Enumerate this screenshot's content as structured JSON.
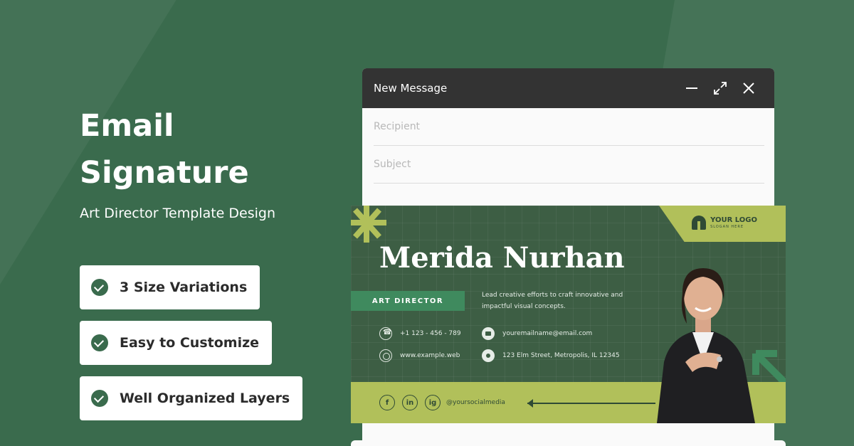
{
  "promo": {
    "headline_line1": "Email",
    "headline_line2": "Signature",
    "subtitle": "Art Director Template Design",
    "features": [
      {
        "label": "3 Size Variations"
      },
      {
        "label": "Easy to Customize"
      },
      {
        "label": "Well Organized Layers"
      }
    ]
  },
  "window": {
    "title": "New Message",
    "recipient_placeholder": "Recipient",
    "subject_placeholder": "Subject"
  },
  "signature": {
    "logo_text": "YOUR LOGO",
    "logo_slogan": "SLOGAN HERE",
    "name": "Merida Nurhan",
    "role": "ART DIRECTOR",
    "bio": "Lead creative efforts to craft innovative and impactful visual concepts.",
    "phone": "+1 123 - 456 - 789",
    "website": "www.example.web",
    "email": "youremailname@email.com",
    "address": "123 Elm Street, Metropolis, IL 12345",
    "social_handle": "@yoursocialmedia",
    "social_icons": [
      "f",
      "in",
      "ig"
    ]
  },
  "colors": {
    "background": "#3a6b4d",
    "card_green": "#3d5e44",
    "accent_lime": "#b1c05a",
    "role_green": "#3f8a5e",
    "titlebar": "#333333"
  }
}
